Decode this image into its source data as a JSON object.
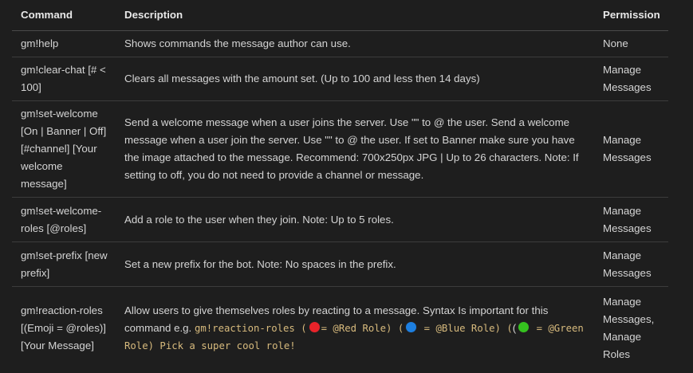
{
  "table": {
    "headers": {
      "command": "Command",
      "description": "Description",
      "permission": "Permission"
    },
    "rows": [
      {
        "command": "gm!help",
        "description": "Shows commands the message author can use.",
        "permission": "None"
      },
      {
        "command": "gm!clear-chat [# < 100]",
        "description": "Clears all messages with the amount set. (Up to 100 and less then 14 days)",
        "permission": "Manage Messages"
      },
      {
        "command": "gm!set-welcome [On | Banner | Off] [#channel] [Your welcome message]",
        "description": "Send a welcome message when a user joins the server. Use \"\" to @ the user. Send a welcome message when a user join the server. Use \"\" to @ the user. If set to Banner make sure you have the image attached to the message. Recommend: 700x250px JPG | Up to 26 characters. Note: If setting to off, you do not need to provide a channel or message.",
        "permission": "Manage Messages"
      },
      {
        "command": "gm!set-welcome-roles [@roles]",
        "description": "Add a role to the user when they join. Note: Up to 5 roles.",
        "permission": "Manage Messages"
      },
      {
        "command": "gm!set-prefix [new prefix]",
        "description": "Set a new prefix for the bot. Note: No spaces in the prefix.",
        "permission": "Manage Messages"
      },
      {
        "command": "gm!reaction-roles [(Emoji = @roles)] [Your Message]",
        "description_prefix": "Allow users to give themselves roles by reacting to a message. Syntax Is important for this command e.g. ",
        "example": {
          "part1": "gm!reaction-roles (",
          "part2": "= @Red Role) (",
          "part3": " = @Blue Role) (",
          "part4": " = @Green Role) Pick a super cool role!"
        },
        "permission": "Manage Messages, Manage Roles"
      }
    ]
  },
  "colors": {
    "background": "#1e1e1e",
    "text": "#d4d4d4",
    "code": "#d7ba7d",
    "red_emoji": "#e8232a",
    "blue_emoji": "#1d7fe0",
    "green_emoji": "#35c21f"
  }
}
